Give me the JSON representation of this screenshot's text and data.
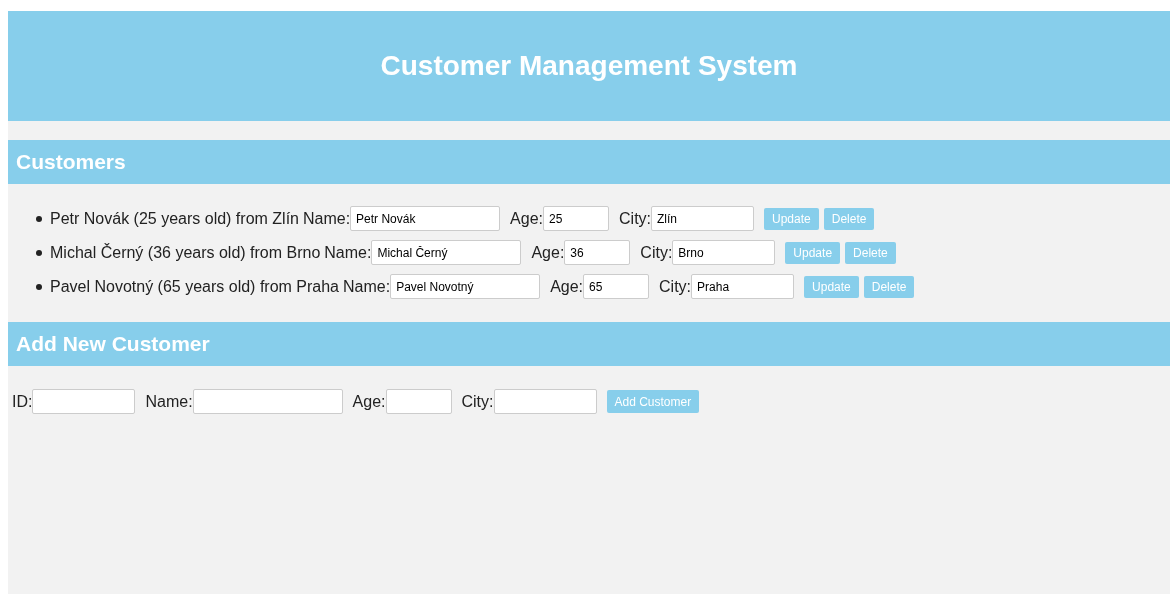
{
  "header": {
    "title": "Customer Management System"
  },
  "customers_section": {
    "heading": "Customers",
    "customers": [
      {
        "summary": "Petr Novák (25 years old) from Zlín",
        "fields": [
          {
            "label": "Name:",
            "value": "Petr Novák"
          },
          {
            "label": "Age:",
            "value": "25"
          },
          {
            "label": "City:",
            "value": "Zlín"
          }
        ],
        "buttons": [
          "Update",
          "Delete"
        ]
      },
      {
        "summary": "Michal Černý (36 years old) from Brno",
        "fields": [
          {
            "label": "Name:",
            "value": "Michal Černý"
          },
          {
            "label": "Age:",
            "value": "36"
          },
          {
            "label": "City:",
            "value": "Brno"
          }
        ],
        "buttons": [
          "Update",
          "Delete"
        ]
      },
      {
        "summary": "Pavel Novotný (65 years old) from Praha",
        "fields": [
          {
            "label": "Name:",
            "value": "Pavel Novotný"
          },
          {
            "label": "Age:",
            "value": "65"
          },
          {
            "label": "City:",
            "value": "Praha"
          }
        ],
        "buttons": [
          "Update",
          "Delete"
        ]
      }
    ]
  },
  "add_section": {
    "heading": "Add New Customer",
    "fields": [
      {
        "label": "ID:"
      },
      {
        "label": "Name:"
      },
      {
        "label": "Age:"
      },
      {
        "label": "City:"
      }
    ],
    "button": "Add Customer"
  }
}
